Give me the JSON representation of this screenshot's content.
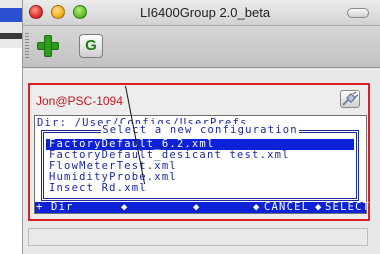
{
  "window": {
    "title": "LI6400Group 2.0_beta"
  },
  "toolbar": {
    "add_icon": "plus-icon",
    "g_label": "G"
  },
  "connection": {
    "label": "Jon@PSC-1094",
    "button_icon": "plug-icon"
  },
  "terminal": {
    "dir_line": "Dir: /User/Configs/UserPrefs",
    "box_title": "Select a new configuration",
    "files": [
      "FactoryDefault_6.2.xml",
      "FactoryDefault_desicant test.xml",
      "FlowMeterTest.xml",
      "HumidityProbe.xml",
      "Insect Rd.xml"
    ],
    "selected_index": 0,
    "commands": {
      "dir": "+ Dir",
      "cancel": "CANCEL",
      "select": "SELECT",
      "separator": "◆"
    }
  },
  "colors": {
    "terminal_text": "#1b2a9a",
    "highlight": "#0d22d6",
    "panel_border": "#d81f2a",
    "add_green": "#2e9d1e"
  }
}
